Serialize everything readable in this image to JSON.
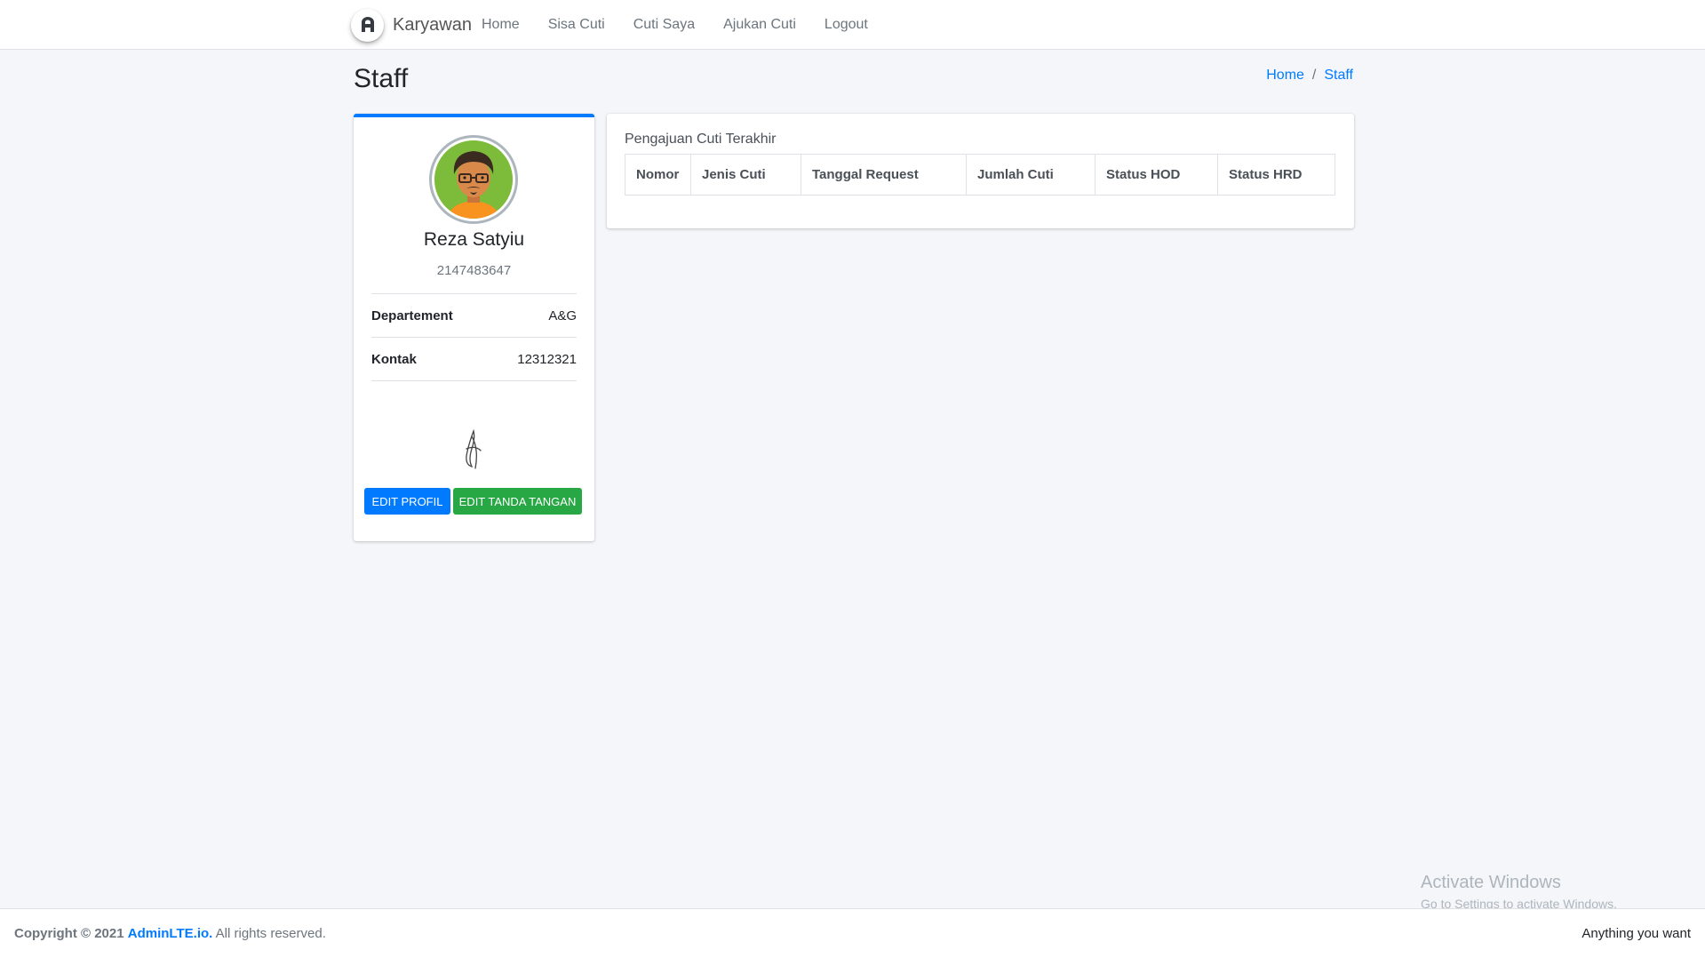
{
  "navbar": {
    "brand_text": "Karyawan",
    "links": [
      {
        "label": "Home"
      },
      {
        "label": "Sisa Cuti"
      },
      {
        "label": "Cuti Saya"
      },
      {
        "label": "Ajukan Cuti"
      },
      {
        "label": "Logout"
      }
    ]
  },
  "header": {
    "title": "Staff",
    "breadcrumb": [
      {
        "label": "Home"
      },
      {
        "label": "Staff"
      }
    ],
    "breadcrumb_sep": "/"
  },
  "profile": {
    "name": "Reza Satyiu",
    "id_number": "2147483647",
    "fields": [
      {
        "label": "Departement",
        "value": "A&G"
      },
      {
        "label": "Kontak",
        "value": "12312321"
      }
    ],
    "edit_profile_label": "EDIT PROFIL",
    "edit_signature_label": "EDIT TANDA TANGAN"
  },
  "leave_requests": {
    "title": "Pengajuan Cuti Terakhir",
    "columns": [
      "Nomor",
      "Jenis Cuti",
      "Tanggal Request",
      "Jumlah Cuti",
      "Status HOD",
      "Status HRD"
    ],
    "rows": []
  },
  "watermark": {
    "title": "Activate Windows",
    "subtitle": "Go to Settings to activate Windows."
  },
  "footer": {
    "copyright_prefix": "Copyright © 2021",
    "brand_link": "AdminLTE.io.",
    "rights": "All rights reserved.",
    "right_text": "Anything you want"
  },
  "colors": {
    "primary": "#007bff",
    "success": "#28a745",
    "background": "#f4f6f9"
  },
  "icons": {
    "brand_logo": "adminlte-logo-icon",
    "avatar": "user-avatar-illustration",
    "signature": "signature-image"
  }
}
